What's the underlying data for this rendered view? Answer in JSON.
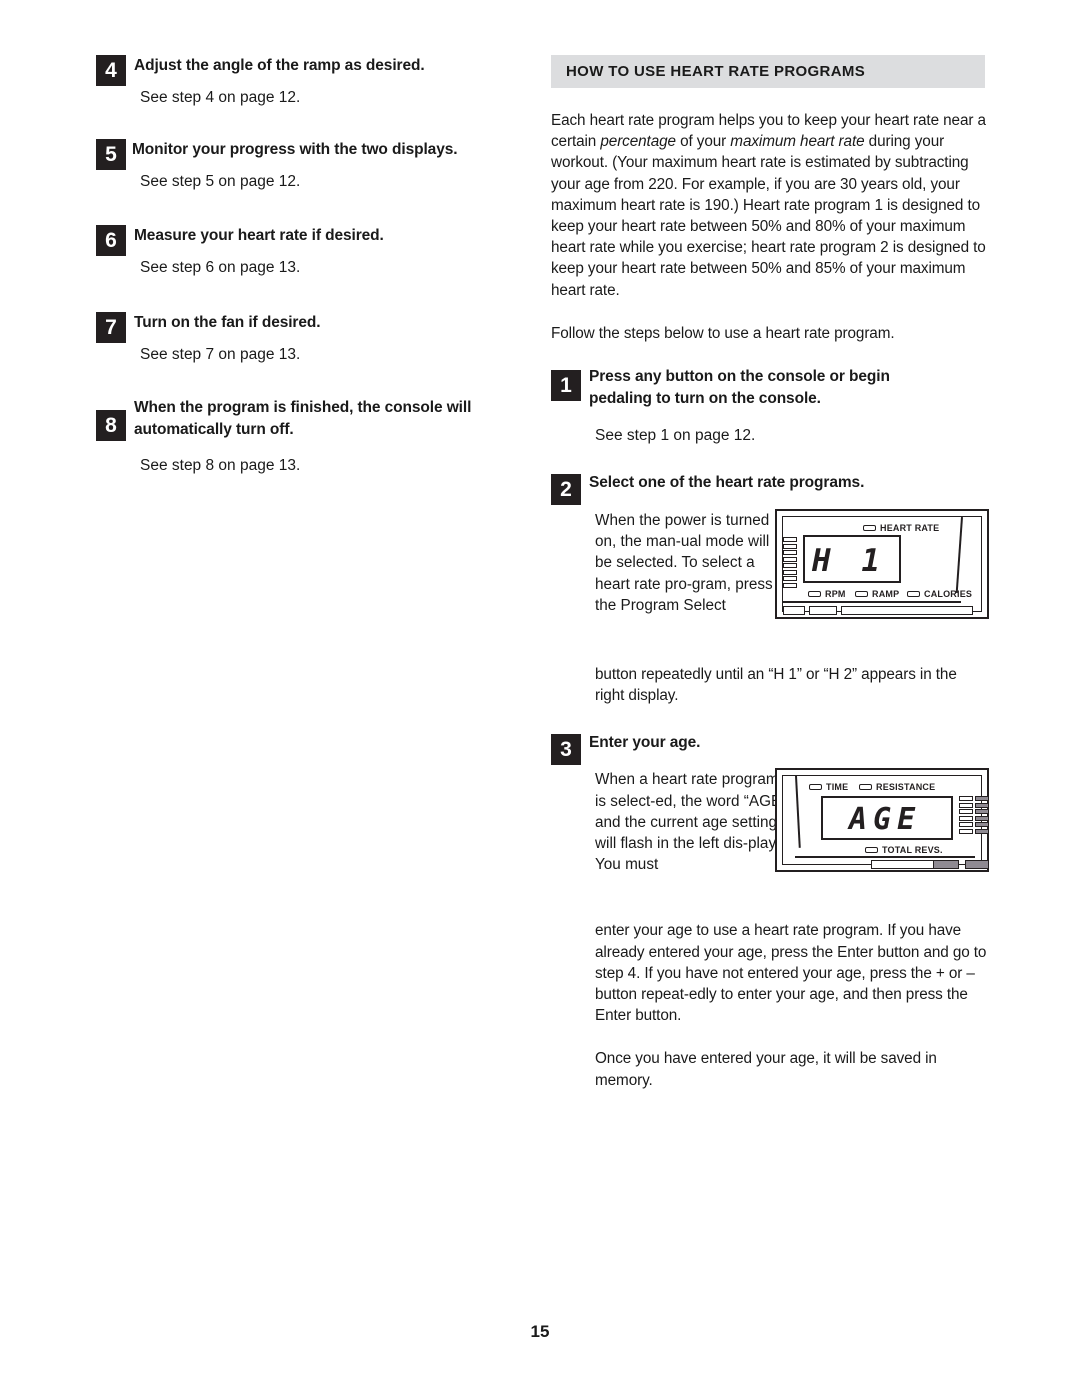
{
  "page": {
    "number": "15"
  },
  "left_column": {
    "steps": [
      {
        "num": "4",
        "title": "Adjust the angle of the ramp as desired.",
        "see": "See step 4 on page 12."
      },
      {
        "num": "5",
        "title": "Monitor your progress with the two displays.",
        "see": "See step 5 on page 12."
      },
      {
        "num": "6",
        "title": "Measure your heart rate if desired.",
        "see": "See step 6 on page 13."
      },
      {
        "num": "7",
        "title": "Turn on the fan if desired.",
        "see": "See step 7 on page 13."
      },
      {
        "num": "8",
        "title": "When the program is finished, the console will automatically turn off.",
        "see": "See step 8 on page 13."
      }
    ]
  },
  "right_column": {
    "section_header": "HOW TO USE HEART RATE PROGRAMS",
    "intro_part1": "Each heart rate program helps you to keep your heart rate near a certain ",
    "intro_italic1": "percentage",
    "intro_part2": " of your ",
    "intro_italic2": "maximum heart rate",
    "intro_part3": " during your workout. (Your maximum heart rate is estimated by subtracting your age from 220. For example, if you are 30 years old, your maximum heart rate is 190.) Heart rate program 1 is designed to keep your heart rate between 50% and 80% of your maximum heart rate while you exercise; heart rate program 2 is designed to keep your heart rate between 50% and 85% of your maximum heart rate.",
    "follow_line": "Follow the steps below to use a heart rate program.",
    "step1": {
      "num": "1",
      "title": "Press any button on the console or begin pedaling to turn on the console.",
      "see": "See step 1 on page 12."
    },
    "step2": {
      "num": "2",
      "title": "Select one of the heart rate programs.",
      "narrow_text": "When the power is turned on, the man-ual mode will be selected. To select a heart rate pro-gram, press the Program Select",
      "wide_text": "button repeatedly until an “H 1” or “H 2” appears in the right display."
    },
    "step3": {
      "num": "3",
      "title": "Enter your age.",
      "narrow_text": "When a heart rate program is select-ed, the word “AGE” and the current age setting will flash in the left dis-play. You must",
      "wide_text": "enter your age to use a heart rate program. If you have already entered your age, press the Enter button and go to step 4. If you have not entered your age, press the + or – button repeat-edly to enter your age, and then press the Enter button.",
      "closing_text": "Once you have entered your age, it will be saved in memory."
    }
  },
  "console_hr": {
    "display_value": "H      1",
    "indicator_top": "HEART RATE",
    "indicators_bottom": [
      "RPM",
      "RAMP",
      "CALORIES"
    ]
  },
  "console_age": {
    "display_value": "AGE",
    "indicators_top": [
      "TIME",
      "RESISTANCE"
    ],
    "indicator_bottom": "TOTAL REVS."
  },
  "colors": {
    "band_bg": "#dcdddf",
    "ink": "#231f20",
    "segment_fill": "#8f8a92"
  }
}
